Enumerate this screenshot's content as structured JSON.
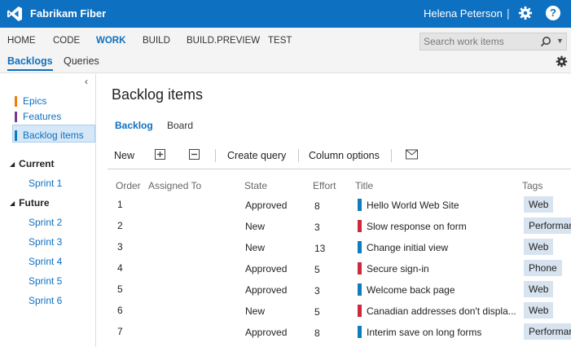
{
  "app": {
    "brand": "Fabrikam Fiber",
    "user": "Helena Peterson",
    "separator": "|",
    "help_label": "?",
    "colors": {
      "accent": "#0e70c0",
      "epic": "#f07c10",
      "feature": "#773b93",
      "backlog_item": "#107bbf",
      "bug": "#cc293d",
      "tag_bg": "#d7e3ef"
    }
  },
  "hubs": [
    "HOME",
    "CODE",
    "WORK",
    "BUILD",
    "BUILD.PREVIEW",
    "TEST"
  ],
  "search": {
    "placeholder": "Search work items"
  },
  "subnav": [
    "Backlogs",
    "Queries"
  ],
  "left": {
    "collapse_icon": "chevron-left-icon",
    "levels": [
      "Epics",
      "Features",
      "Backlog items"
    ],
    "current_label": "Current",
    "current_sprints": [
      "Sprint 1"
    ],
    "future_label": "Future",
    "future_sprints": [
      "Sprint 2",
      "Sprint 3",
      "Sprint 4",
      "Sprint 5",
      "Sprint 6"
    ]
  },
  "main": {
    "title": "Backlog items",
    "view_tabs": [
      "Backlog",
      "Board"
    ],
    "toolbar": {
      "new": "New",
      "create_query": "Create query",
      "column_options": "Column options"
    },
    "columns": [
      "Order",
      "Assigned To",
      "State",
      "Effort",
      "Title",
      "Tags"
    ],
    "rows": [
      {
        "order": "1",
        "state": "Approved",
        "effort": "8",
        "type": "backlog_item",
        "title": "Hello World Web Site",
        "tag": "Web"
      },
      {
        "order": "2",
        "state": "New",
        "effort": "3",
        "type": "bug",
        "title": "Slow response on form",
        "tag": "Performance"
      },
      {
        "order": "3",
        "state": "New",
        "effort": "13",
        "type": "backlog_item",
        "title": "Change initial view",
        "tag": "Web"
      },
      {
        "order": "4",
        "state": "Approved",
        "effort": "5",
        "type": "bug",
        "title": "Secure sign-in",
        "tag": "Phone"
      },
      {
        "order": "5",
        "state": "Approved",
        "effort": "3",
        "type": "backlog_item",
        "title": "Welcome back page",
        "tag": "Web"
      },
      {
        "order": "6",
        "state": "New",
        "effort": "5",
        "type": "bug",
        "title": "Canadian addresses don't displa...",
        "tag": "Web"
      },
      {
        "order": "7",
        "state": "Approved",
        "effort": "8",
        "type": "backlog_item",
        "title": "Interim save on long forms",
        "tag": "Performance"
      }
    ]
  }
}
